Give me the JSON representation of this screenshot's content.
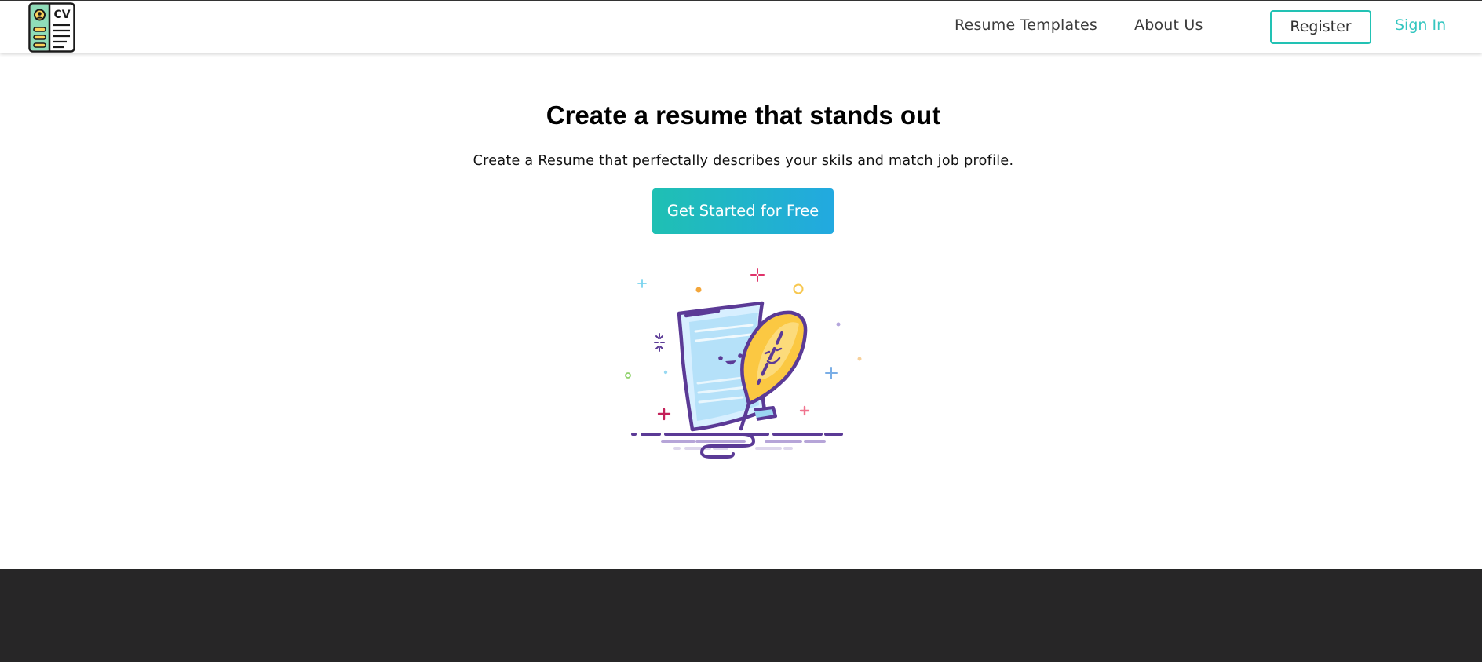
{
  "brand": {
    "logo_icon": "cv-document-icon",
    "logo_text": "CV"
  },
  "nav": {
    "resume_templates": "Resume Templates",
    "about_us": "About Us",
    "register": "Register",
    "sign_in": "Sign In"
  },
  "hero": {
    "title": "Create a resume that stands out",
    "subtitle": "Create a Resume that perfectally describes your skils and match job profile.",
    "cta_label": "Get Started for Free",
    "illustration_icon": "document-and-quill-icon"
  },
  "colors": {
    "accent_teal": "#22c2b4",
    "accent_blue": "#22a9e0",
    "sign_in": "#34c6c0",
    "footer_bg": "#272627",
    "illustration_purple": "#5b3a96",
    "illustration_yellow": "#fbc842"
  }
}
